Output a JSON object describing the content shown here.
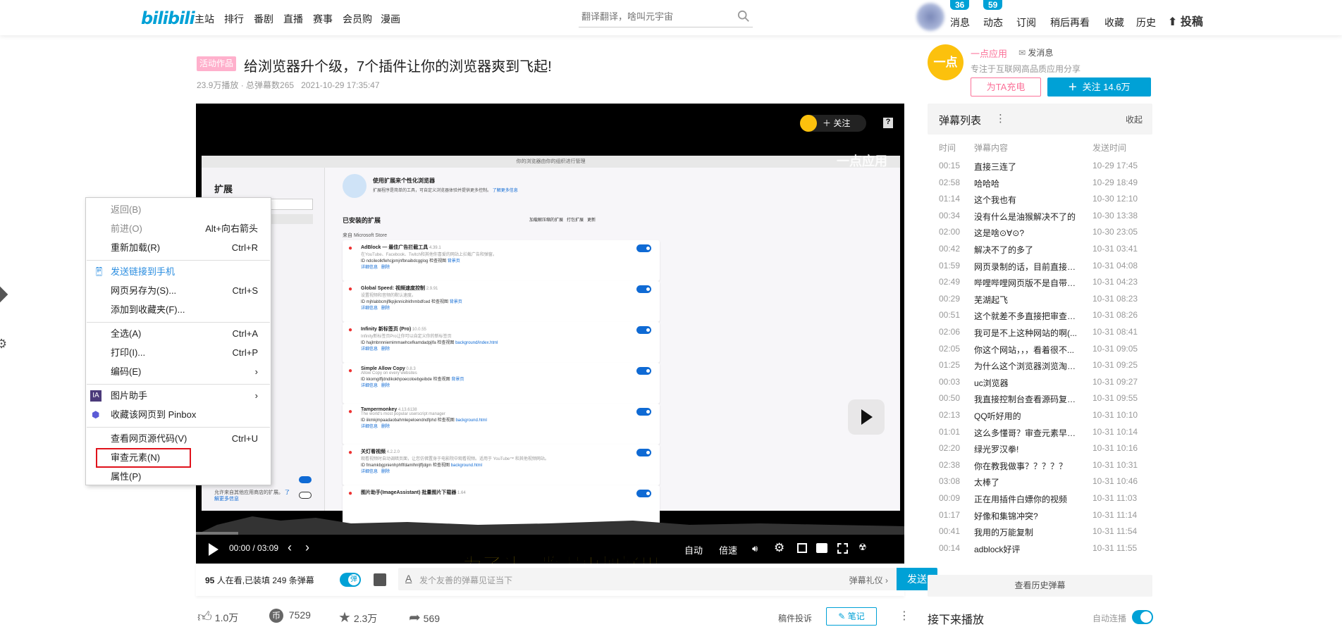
{
  "header": {
    "logo": "bilibili",
    "nav": [
      "主站",
      "排行",
      "番剧",
      "直播",
      "赛事",
      "会员购",
      "漫画"
    ],
    "search_placeholder": "翻译翻译，啥叫元宇宙",
    "right": [
      "消息",
      "动态",
      "订阅",
      "稍后再看",
      "收藏",
      "历史"
    ],
    "badges": {
      "messages": "36",
      "dynamics": "59"
    },
    "upload": "投稿"
  },
  "video": {
    "tag": "活动作品",
    "title": "给浏览器升个级，7个插件让你的浏览器爽到飞起!",
    "views": "23.9万播放",
    "danmaku_total": "· 总弹幕数265",
    "date": "2021-10-29 17:35:47"
  },
  "player": {
    "follow_label": "关注",
    "watermark": "一点应用",
    "subtitle": "为了让浏览器更加好用",
    "time": "00:00 / 03:09",
    "auto": "自动",
    "speed": "倍速",
    "progress": 0.0
  },
  "inner_page": {
    "lock_text": "你的浏览器由你的组织进行管理",
    "side_title": "扩展",
    "hero_title": "使用扩展来个性化浏览器",
    "hero_desc": "扩展程序是简单的工具，可自定义浏览器体验并提供更多控制。",
    "hero_link": "了解更多信息",
    "installed": "已安装的扩展",
    "load": "加载解压缩的扩展",
    "pack": "打包扩展",
    "update": "更新",
    "source": "来自 Microsoft Store",
    "side_note": "允许来自其他应用商店的扩展。",
    "side_link": "了解更多信息",
    "extensions": [
      {
        "name": "AdBlock — 最佳广告拦截工具",
        "ver": "4.39.1",
        "desc": "在YouTube、Facebook、Twitch和其他你喜爱的网站上拦截广告和弹窗。",
        "id": "ID ndcileolkflehcjpmjnfbnaibdcgglog",
        "view": "检查视图",
        "page": "背景页"
      },
      {
        "name": "Global Speed: 视频速度控制",
        "ver": "2.9.91",
        "desc": "设置视频和音频的默认速度。",
        "id": "ID mjhlabbcmjflkpjknnicihkfnmbdfced",
        "view": "检查视图",
        "page": "背景页"
      },
      {
        "name": "Infinity 新标签页 (Pro)",
        "ver": "10.0.55",
        "desc": "Infinity新标签页Pro让你可以自定义你的新标签页",
        "id": "ID hajlmbnnniemimmaehcefkamdadpjlfa",
        "view": "检查视图",
        "page": "background/index.html"
      },
      {
        "name": "Simple Allow Copy",
        "ver": "0.8.3",
        "desc": "Allow Copy on every websites",
        "id": "ID kkomgiffjdndikokhpoecoloebgeibde",
        "view": "检查视图",
        "page": "背景页"
      },
      {
        "name": "Tampermonkey",
        "ver": "4.13.6138",
        "desc": "The world's most popular userscript manager",
        "id": "ID iikmkjmpaadaobahmlepeloendndfphd",
        "view": "检查视图",
        "page": "background.html"
      },
      {
        "name": "关灯看视频",
        "ver": "4.2.2.0",
        "desc": "观看视频时自动调暗页面，让您仿佛置身于电影院中观看视频。适用于 YouTube™ 和其他视频网站。",
        "id": "ID fmamkbgpnienhphflfdamlhnljffjdgm",
        "view": "检查视图",
        "page": "background.html"
      },
      {
        "name": "图片助手(ImageAssistant) 批量图片下载器",
        "ver": "1.64",
        "desc": "",
        "id": "",
        "view": "",
        "page": ""
      }
    ],
    "details": "详细信息",
    "remove": "删除"
  },
  "below": {
    "watching": "95",
    "watching_text": "人在看,已装填 249 条弹幕",
    "dm_toggle": "弹",
    "placeholder": "发个友善的弹幕见证当下",
    "etiquette": "弹幕礼仪 ›",
    "send": "发送"
  },
  "actions": {
    "like": "1.0万",
    "coin": "7529",
    "fav": "2.3万",
    "share": "569",
    "report": "稿件投诉",
    "note": "笔记"
  },
  "uploader": {
    "avatar_text": "一点",
    "name": "一点应用",
    "message": "发消息",
    "desc": "专注于互联网高品质应用分享",
    "charge": "为TA充电",
    "follow": "关注 14.6万"
  },
  "danmaku": {
    "title": "弹幕列表",
    "collapse": "收起",
    "cols": [
      "时间",
      "弹幕内容",
      "发送时间"
    ],
    "history": "查看历史弹幕",
    "rows": [
      [
        "00:15",
        "直接三连了",
        "10-29 17:45"
      ],
      [
        "02:58",
        "哈哈哈",
        "10-29 18:49"
      ],
      [
        "01:14",
        "这个我也有",
        "10-30 12:10"
      ],
      [
        "00:34",
        "没有什么是油猴解决不了的",
        "10-30 13:38"
      ],
      [
        "02:00",
        "这是啥⊙∀⊙?",
        "10-30 23:05"
      ],
      [
        "00:42",
        "解决不了的多了",
        "10-31 03:41"
      ],
      [
        "01:59",
        "网页录制的话，目前直接使...",
        "10-31 04:08"
      ],
      [
        "02:49",
        "哔哩哔哩网页版不是自带这...",
        "10-31 04:23"
      ],
      [
        "00:29",
        "芜湖起飞",
        "10-31 08:23"
      ],
      [
        "00:51",
        "这个就差不多直接把审查里...",
        "10-31 08:26"
      ],
      [
        "02:06",
        "我可是不上这种网站的啊(...",
        "10-31 08:41"
      ],
      [
        "02:05",
        "你这个网站，，，看着很不...",
        "10-31 09:05"
      ],
      [
        "01:25",
        "为什么这个浏览器浏览淘宝...",
        "10-31 09:25"
      ],
      [
        "00:03",
        "uc浏览器",
        "10-31 09:27"
      ],
      [
        "00:50",
        "我直接控制台查看源码复制...",
        "10-31 09:55"
      ],
      [
        "02:13",
        "QQ听好用的",
        "10-31 10:10"
      ],
      [
        "01:01",
        "这么多懂哥？审查元素早就...",
        "10-31 10:14"
      ],
      [
        "02:20",
        "绿光罗汉拳!",
        "10-31 10:16"
      ],
      [
        "02:38",
        "你在教我做事？？？？？",
        "10-31 10:31"
      ],
      [
        "03:08",
        "太棒了",
        "10-31 10:46"
      ],
      [
        "00:09",
        "正在用插件白嫖你的视频",
        "10-31 11:03"
      ],
      [
        "01:17",
        "好像和集锦冲突?",
        "10-31 11:14"
      ],
      [
        "00:41",
        "我用的万能复制",
        "10-31 11:54"
      ],
      [
        "00:14",
        "adblock好评",
        "10-31 11:55"
      ]
    ]
  },
  "next": {
    "title": "接下来播放",
    "autoplay": "自动连播",
    "autoplay_on": true
  },
  "context_menu": {
    "items": [
      {
        "label": "返回(B)",
        "shortcut": "",
        "disabled": true
      },
      {
        "label": "前进(O)",
        "shortcut": "Alt+向右箭头",
        "disabled": true
      },
      {
        "label": "重新加载(R)",
        "shortcut": "Ctrl+R"
      },
      "sep",
      {
        "label": "发送链接到手机",
        "shortcut": "",
        "icon": "phone-send-icon",
        "blue": true
      },
      {
        "label": "网页另存为(S)...",
        "shortcut": "Ctrl+S"
      },
      {
        "label": "添加到收藏夹(F)...",
        "shortcut": ""
      },
      "sep",
      {
        "label": "全选(A)",
        "shortcut": "Ctrl+A"
      },
      {
        "label": "打印(I)...",
        "shortcut": "Ctrl+P"
      },
      {
        "label": "编码(E)",
        "shortcut": "›"
      },
      "sep",
      {
        "label": "图片助手",
        "shortcut": "›",
        "icon": "image-assistant-icon"
      },
      {
        "label": "收藏该网页到 Pinbox",
        "shortcut": "",
        "icon": "pinbox-icon"
      },
      "sep",
      {
        "label": "查看网页源代码(V)",
        "shortcut": "Ctrl+U"
      },
      {
        "label": "审查元素(N)",
        "shortcut": "",
        "highlight": true
      },
      {
        "label": "属性(P)",
        "shortcut": ""
      }
    ]
  },
  "colors": {
    "accent": "#00a1d6",
    "pink": "#fb7299",
    "highlight": "#e0121b"
  }
}
